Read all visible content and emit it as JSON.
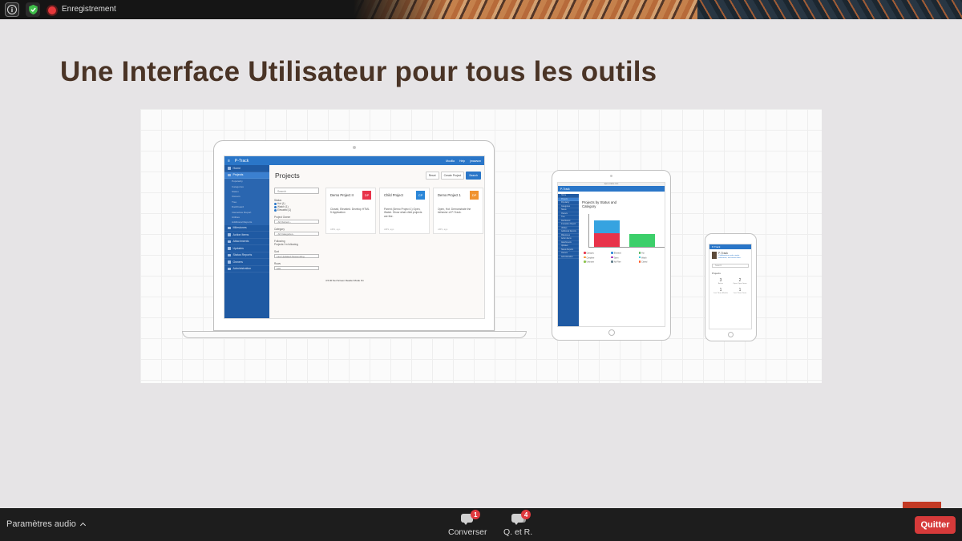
{
  "top_bar": {
    "recording_label": "Enregistrement",
    "icons": [
      "info-icon",
      "shield-check-icon",
      "record-icon"
    ]
  },
  "slide": {
    "title": "Une Interface Utilisateur pour tous les outils",
    "laptop_app": {
      "app_name": "P-Track",
      "header_links": [
        "Mozilla",
        "Help",
        "jmawson"
      ],
      "page_title": "Projects",
      "toolbar": {
        "reset": "Reset",
        "create": "Create Project",
        "search": "Search"
      },
      "sidebar": {
        "items": [
          "Home",
          "Projects"
        ],
        "sub_items": [
          "Popularity",
          "Categories",
          "Status",
          "Owners",
          "Tree",
          "Dashboard",
          "Interactive Report",
          "Utilities",
          "Additional Reports"
        ],
        "bottom_items": [
          "Milestones",
          "Action Items",
          "Attachments",
          "Updates",
          "Status Reports",
          "Owners",
          "Administration"
        ]
      },
      "filters": {
        "search_placeholder": "Search",
        "status_label": "Status",
        "status_options": [
          "Hot (1)",
          "Watch (1)",
          "Elevated (1)"
        ],
        "owner_label": "Project Owner",
        "owner_value": "- All Owners -",
        "category_label": "Category",
        "category_value": "- All Categories -",
        "following_label": "Following",
        "following_option": "Projects I'm following",
        "sort_label": "Sort",
        "sort_value": "Last Updated Descending",
        "rows_label": "Rows",
        "rows_value": "100"
      },
      "cards": [
        {
          "name": "Demo Project II",
          "badge": "DP",
          "color": "#e8334a",
          "desc": "Closed, Elevated. Develop HTML 5 Application",
          "foot": "AMS, ago"
        },
        {
          "name": "Child Project",
          "badge": "CP",
          "color": "#2a86d8",
          "desc": "Parent (Demo Project 1) Open, Watch. Show what child projects are like.",
          "foot": "AMS, ago"
        },
        {
          "name": "Demo Project 1",
          "badge": "DP",
          "color": "#f0932f",
          "desc": "Open, Hot. Demonstrate the behavior of P-Track.",
          "foot": "AMS, ago"
        }
      ],
      "footer_note": "4.5.00  Set Screen Reader Mode On"
    },
    "tablet_app": {
      "app_name": "P-Track",
      "title": "Projects by Status and Category",
      "sidebar_rows": [
        "Home",
        "Projects",
        "Popularity",
        "Categories",
        "Status",
        "Owners",
        "Tree",
        "Dashboard",
        "Interactive Report",
        "Utilities",
        "Additional Reports",
        "Milestones",
        "Action Items",
        "Attachments",
        "Updates",
        "Status Reports",
        "Owners",
        "Administration"
      ],
      "legend": [
        "Category",
        "Elevated",
        "Hot",
        "Complete",
        "Open",
        "Watch",
        "Unknown",
        "No Filter",
        "Closed"
      ],
      "legend_colors": [
        "#e8334a",
        "#2a86d8",
        "#4caf50",
        "#f0932f",
        "#9c27b0",
        "#00bcd4",
        "#8bc34a",
        "#607d8b",
        "#ff5722"
      ],
      "bars": [
        {
          "stack": [
            {
              "value": 40,
              "color": "#e8334a"
            },
            {
              "value": 38,
              "color": "#36a3e0"
            }
          ]
        },
        {
          "stack": [
            {
              "value": 38,
              "color": "#3ccf6a"
            }
          ]
        }
      ],
      "ymax": 100
    },
    "phone_app": {
      "app_name": "P-Track",
      "brand": "P-Track",
      "brand_sub": "Collaboration made simple, milestones, and action items.",
      "search_placeholder": "Search",
      "section": "Projects",
      "stats": [
        {
          "value": "3",
          "label": "Active"
        },
        {
          "value": "2",
          "label": "Open Open Items"
        },
        {
          "value": "1",
          "label": "Last Three Months"
        },
        {
          "value": "1",
          "label": "Last Three Years"
        }
      ]
    }
  },
  "bottom_bar": {
    "audio_settings": "Paramètres audio",
    "chat": {
      "label": "Converser",
      "count": "1"
    },
    "qa": {
      "label": "Q. et R.",
      "count": "4"
    },
    "quit": "Quitter"
  },
  "colors": {
    "accent_red": "#d63a3a",
    "title_brown": "#4a3426",
    "app_blue": "#2a76c8"
  }
}
